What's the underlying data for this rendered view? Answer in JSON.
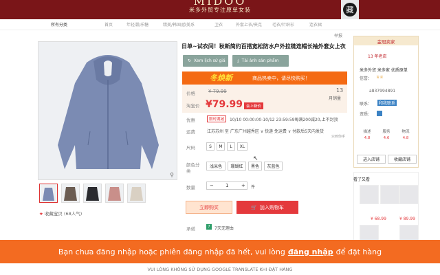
{
  "header": {
    "brand_name": "MIDOO",
    "brand_slogan": "米多外贸专注原单女装",
    "seal_char": "藏"
  },
  "categories": [
    "所有分类",
    "首页",
    "年轻潮/乐糖",
    "精美/韩国/欧美系",
    "卫衣",
    "外套上衣/夹克",
    "毛衣/针织衫",
    "连衣裙"
  ],
  "gallery": {
    "zoom_icon": "magnifier-icon",
    "thumb_count": 5
  },
  "favorite": {
    "label": "收藏宝贝",
    "count": "(68人气)"
  },
  "product": {
    "report": "举报",
    "title": "日单~试衣间！秋新简约百搭宽松防水户外拉链连帽长袖外套女上衣",
    "translate_buttons": [
      "Xem lịch sử giá",
      "Tải ảnh sản phẩm"
    ],
    "promo_tag": "冬焕新",
    "promo_text": "商品热卖中，请尽快购买！",
    "price_label": "价格",
    "old_price": "¥ 79.99",
    "sale_label": "淘宝价",
    "new_price": "¥79.99",
    "price_badge": "会上新价",
    "sales_count": "13",
    "sales_label": "月销量",
    "promo_label": "优惠",
    "promo_tag_small": "限时满减",
    "promo_detail": "10/10 00:00:00-10/12 23:59:59每满200减20,上不封顶",
    "shipping_label": "运费",
    "shipping_text": "江苏苏州 至 广东广州越秀区 ∨ 快递 免运费 ∨ 付款后5天内发货",
    "shipping_note": "只到你手",
    "size_label": "尺码",
    "sizes": [
      "S",
      "M",
      "L",
      "XL"
    ],
    "color_label": "颜色分类",
    "colors": [
      "浅米色",
      "珊瑚红",
      "黑色",
      "灰蓝色"
    ],
    "qty_label": "数量",
    "qty_minus": "−",
    "qty_value": "1",
    "qty_plus": "+",
    "qty_unit": "件",
    "buy_now": "立即购买",
    "add_cart": "加入购物车",
    "promise_label": "承诺",
    "promise_text": "7天无理由"
  },
  "seller": {
    "header": "金冠卖家",
    "years": "13 年老店",
    "shop_name": "米多外贸 米多家 优质原单",
    "credit_label": "信誉：",
    "phone": "a837994891",
    "contact_label": "联系：",
    "contact_badge": "和我联系",
    "qualification_label": "资质：",
    "ratings": [
      {
        "label": "描述",
        "value": "4.8"
      },
      {
        "label": "服务",
        "value": "4.6"
      },
      {
        "label": "物流",
        "value": "4.8"
      }
    ],
    "enter_shop": "进入店铺",
    "favorite_shop": "收藏店铺"
  },
  "also_bought": {
    "title": "看了又看",
    "prices": [
      "¥ 68.99",
      "¥ 89.99"
    ]
  },
  "notice": {
    "prefix": "Bạn chưa đăng nhập hoặc phiên đăng nhập đã hết, vui lòng",
    "link": "đăng nhập",
    "suffix": "để đặt hàng"
  },
  "footer": {
    "text": "VUI LÒNG KHÔNG SỬ DỤNG GOOGLE TRANSLATE KHI ĐẶT HÀNG"
  },
  "colors": {
    "banner": "#7a1518",
    "accent": "#e4393c",
    "notice": "#f36b21",
    "promo": "#f46a13"
  }
}
